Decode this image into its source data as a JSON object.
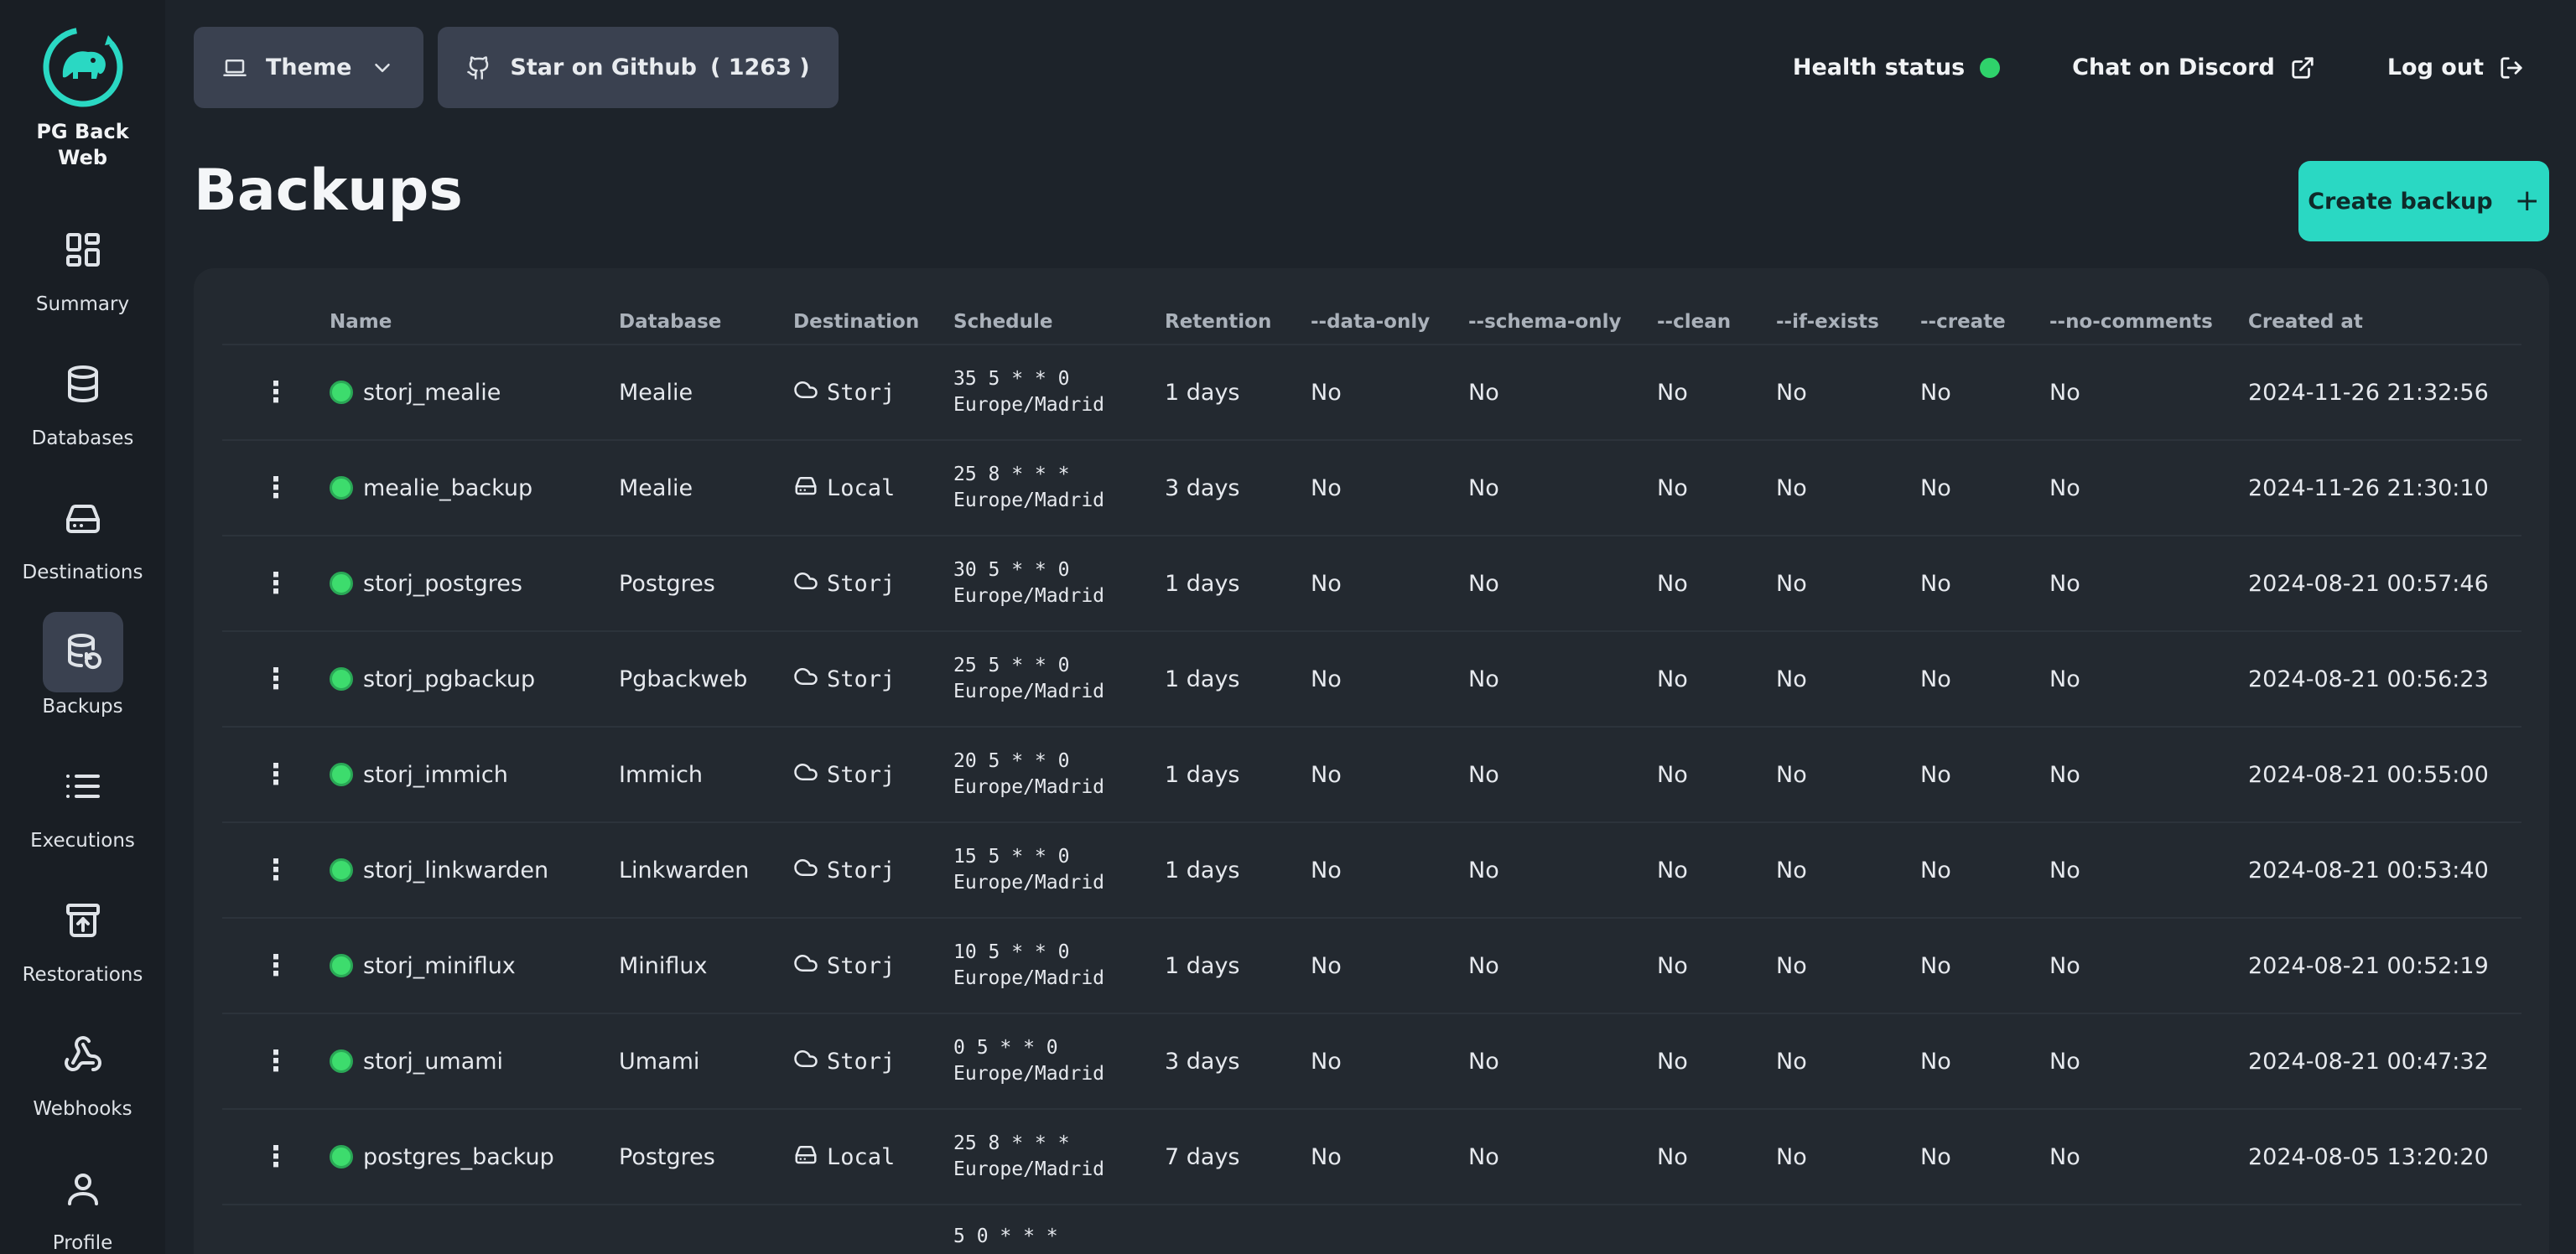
{
  "app": {
    "name": "PG Back Web"
  },
  "sidebar": {
    "items": [
      {
        "label": "Summary",
        "icon": "dashboard-icon",
        "active": false
      },
      {
        "label": "Databases",
        "icon": "database-icon",
        "active": false
      },
      {
        "label": "Destinations",
        "icon": "hard-drive-icon",
        "active": false
      },
      {
        "label": "Backups",
        "icon": "database-restore-icon",
        "active": true
      },
      {
        "label": "Executions",
        "icon": "list-icon",
        "active": false
      },
      {
        "label": "Restorations",
        "icon": "archive-upload-icon",
        "active": false
      },
      {
        "label": "Webhooks",
        "icon": "webhook-icon",
        "active": false
      },
      {
        "label": "Profile",
        "icon": "user-icon",
        "active": false
      }
    ]
  },
  "topbar": {
    "theme_label": "Theme",
    "github_label": "Star on Github",
    "github_count": "( 1263 )",
    "health_label": "Health status",
    "health_color": "#2fd26b",
    "discord_label": "Chat on Discord",
    "logout_label": "Log out"
  },
  "page": {
    "title": "Backups",
    "create_label": "Create backup"
  },
  "table": {
    "headers": [
      "Name",
      "Database",
      "Destination",
      "Schedule",
      "Retention",
      "--data-only",
      "--schema-only",
      "--clean",
      "--if-exists",
      "--create",
      "--no-comments",
      "Created at"
    ],
    "rows": [
      {
        "name": "storj_mealie",
        "database": "Mealie",
        "destination": "Storj",
        "dest_type": "cloud",
        "schedule_cron": "35 5 * * 0",
        "schedule_tz": "Europe/Madrid",
        "retention": "1 days",
        "data_only": "No",
        "schema_only": "No",
        "clean": "No",
        "if_exists": "No",
        "create": "No",
        "no_comments": "No",
        "created_at": "2024-11-26 21:32:56"
      },
      {
        "name": "mealie_backup",
        "database": "Mealie",
        "destination": "Local",
        "dest_type": "local",
        "schedule_cron": "25 8 * * *",
        "schedule_tz": "Europe/Madrid",
        "retention": "3 days",
        "data_only": "No",
        "schema_only": "No",
        "clean": "No",
        "if_exists": "No",
        "create": "No",
        "no_comments": "No",
        "created_at": "2024-11-26 21:30:10"
      },
      {
        "name": "storj_postgres",
        "database": "Postgres",
        "destination": "Storj",
        "dest_type": "cloud",
        "schedule_cron": "30 5 * * 0",
        "schedule_tz": "Europe/Madrid",
        "retention": "1 days",
        "data_only": "No",
        "schema_only": "No",
        "clean": "No",
        "if_exists": "No",
        "create": "No",
        "no_comments": "No",
        "created_at": "2024-08-21 00:57:46"
      },
      {
        "name": "storj_pgbackup",
        "database": "Pgbackweb",
        "destination": "Storj",
        "dest_type": "cloud",
        "schedule_cron": "25 5 * * 0",
        "schedule_tz": "Europe/Madrid",
        "retention": "1 days",
        "data_only": "No",
        "schema_only": "No",
        "clean": "No",
        "if_exists": "No",
        "create": "No",
        "no_comments": "No",
        "created_at": "2024-08-21 00:56:23"
      },
      {
        "name": "storj_immich",
        "database": "Immich",
        "destination": "Storj",
        "dest_type": "cloud",
        "schedule_cron": "20 5 * * 0",
        "schedule_tz": "Europe/Madrid",
        "retention": "1 days",
        "data_only": "No",
        "schema_only": "No",
        "clean": "No",
        "if_exists": "No",
        "create": "No",
        "no_comments": "No",
        "created_at": "2024-08-21 00:55:00"
      },
      {
        "name": "storj_linkwarden",
        "database": "Linkwarden",
        "destination": "Storj",
        "dest_type": "cloud",
        "schedule_cron": "15 5 * * 0",
        "schedule_tz": "Europe/Madrid",
        "retention": "1 days",
        "data_only": "No",
        "schema_only": "No",
        "clean": "No",
        "if_exists": "No",
        "create": "No",
        "no_comments": "No",
        "created_at": "2024-08-21 00:53:40"
      },
      {
        "name": "storj_miniflux",
        "database": "Miniflux",
        "destination": "Storj",
        "dest_type": "cloud",
        "schedule_cron": "10 5 * * 0",
        "schedule_tz": "Europe/Madrid",
        "retention": "1 days",
        "data_only": "No",
        "schema_only": "No",
        "clean": "No",
        "if_exists": "No",
        "create": "No",
        "no_comments": "No",
        "created_at": "2024-08-21 00:52:19"
      },
      {
        "name": "storj_umami",
        "database": "Umami",
        "destination": "Storj",
        "dest_type": "cloud",
        "schedule_cron": "0 5 * * 0",
        "schedule_tz": "Europe/Madrid",
        "retention": "3 days",
        "data_only": "No",
        "schema_only": "No",
        "clean": "No",
        "if_exists": "No",
        "create": "No",
        "no_comments": "No",
        "created_at": "2024-08-21 00:47:32"
      },
      {
        "name": "postgres_backup",
        "database": "Postgres",
        "destination": "Local",
        "dest_type": "local",
        "schedule_cron": "25 8 * * *",
        "schedule_tz": "Europe/Madrid",
        "retention": "7 days",
        "data_only": "No",
        "schema_only": "No",
        "clean": "No",
        "if_exists": "No",
        "create": "No",
        "no_comments": "No",
        "created_at": "2024-08-05 13:20:20"
      }
    ],
    "partial_row_schedule": "5 0 * * *"
  }
}
